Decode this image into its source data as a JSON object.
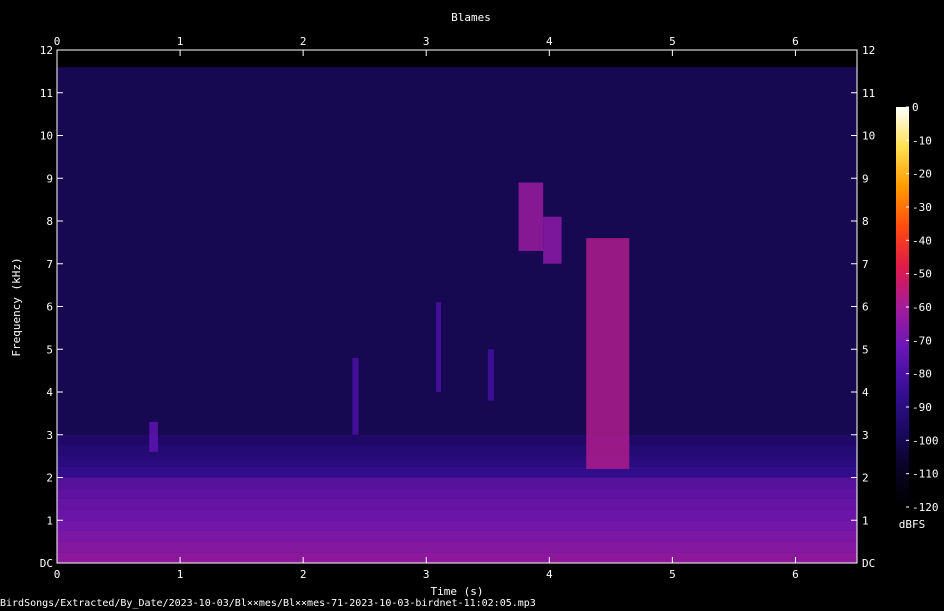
{
  "chart_data": {
    "type": "heatmap",
    "title": "Blames",
    "xlabel": "Time (s)",
    "ylabel": "Frequency (kHz)",
    "xlim": [
      0,
      6.5
    ],
    "ylim": [
      0,
      12
    ],
    "x_ticks": [
      "0",
      "1",
      "2",
      "3",
      "4",
      "5",
      "6"
    ],
    "y_ticks": [
      "DC",
      "1",
      "2",
      "3",
      "4",
      "5",
      "6",
      "7",
      "8",
      "9",
      "10",
      "11",
      "12"
    ],
    "colorbar": {
      "label": "dBFS",
      "ticks": [
        "0",
        "-10",
        "-20",
        "-30",
        "-40",
        "-50",
        "-60",
        "-70",
        "-80",
        "-90",
        "-100",
        "-110",
        "-120"
      ],
      "range": [
        -120,
        0
      ]
    },
    "features": [
      {
        "t_start": 0.75,
        "t_end": 0.82,
        "f_low": 2.6,
        "f_high": 3.3,
        "level_db": -75
      },
      {
        "t_start": 2.4,
        "t_end": 2.45,
        "f_low": 3.0,
        "f_high": 4.8,
        "level_db": -80
      },
      {
        "t_start": 3.08,
        "t_end": 3.12,
        "f_low": 4.0,
        "f_high": 6.1,
        "level_db": -80
      },
      {
        "t_start": 3.5,
        "t_end": 3.55,
        "f_low": 3.8,
        "f_high": 5.0,
        "level_db": -82
      },
      {
        "t_start": 3.75,
        "t_end": 3.95,
        "f_low": 7.3,
        "f_high": 8.9,
        "level_db": -62
      },
      {
        "t_start": 3.95,
        "t_end": 4.1,
        "f_low": 7.0,
        "f_high": 8.1,
        "level_db": -65
      },
      {
        "t_start": 4.3,
        "t_end": 4.65,
        "f_low": 2.2,
        "f_high": 7.6,
        "level_db": -58
      },
      {
        "t_start": 0.0,
        "t_end": 6.5,
        "f_low": 0.0,
        "f_high": 2.0,
        "level_db": -65
      }
    ]
  },
  "footer": {
    "file_path": "BirdSongs/Extracted/By_Date/2023-10-03/Bl××mes/Bl××mes-71-2023-10-03-birdnet-11:02:05.mp3"
  }
}
